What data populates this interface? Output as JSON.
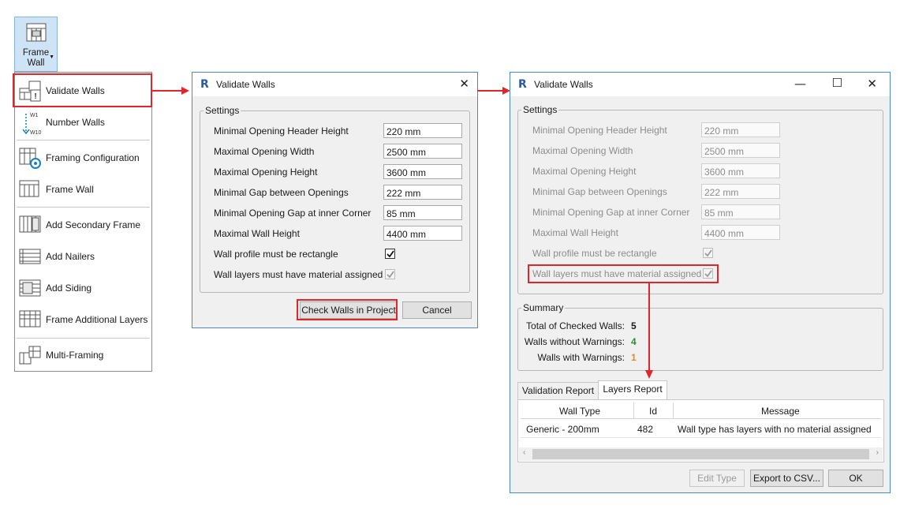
{
  "ribbon": {
    "label_line1": "Frame",
    "label_line2": "Wall"
  },
  "menu": {
    "items": [
      {
        "label": "Validate Walls"
      },
      {
        "label": "Number Walls"
      },
      {
        "label": "Framing Configuration"
      },
      {
        "label": "Frame Wall"
      },
      {
        "label": "Add Secondary Frame"
      },
      {
        "label": "Add Nailers"
      },
      {
        "label": "Add Siding"
      },
      {
        "label": "Frame Additional Layers"
      },
      {
        "label": "Multi-Framing"
      }
    ],
    "number_walls_icon_top": "W1",
    "number_walls_icon_bottom": "W10"
  },
  "dialog1": {
    "title": "Validate Walls",
    "logo": "R",
    "settings_legend": "Settings",
    "rows": [
      {
        "label": "Minimal Opening Header Height",
        "value": "220 mm"
      },
      {
        "label": "Maximal Opening Width",
        "value": "2500 mm"
      },
      {
        "label": "Maximal Opening Height",
        "value": "3600 mm"
      },
      {
        "label": "Minimal Gap between Openings",
        "value": "222 mm"
      },
      {
        "label": "Minimal Opening Gap at inner Corner",
        "value": "85 mm"
      },
      {
        "label": "Maximal Wall Height",
        "value": "4400 mm"
      }
    ],
    "checks": [
      {
        "label": "Wall profile must be rectangle",
        "checked": true
      },
      {
        "label": "Wall layers must have material assigned",
        "checked": true
      }
    ],
    "check_button": "Check Walls in Project",
    "cancel_button": "Cancel"
  },
  "dialog2": {
    "title": "Validate Walls",
    "logo": "R",
    "settings_legend": "Settings",
    "rows": [
      {
        "label": "Minimal Opening Header Height",
        "value": "220 mm"
      },
      {
        "label": "Maximal Opening Width",
        "value": "2500 mm"
      },
      {
        "label": "Maximal Opening Height",
        "value": "3600 mm"
      },
      {
        "label": "Minimal Gap between Openings",
        "value": "222 mm"
      },
      {
        "label": "Minimal Opening Gap at inner Corner",
        "value": "85 mm"
      },
      {
        "label": "Maximal Wall Height",
        "value": "4400 mm"
      }
    ],
    "checks": [
      {
        "label": "Wall profile must be rectangle",
        "checked": true
      },
      {
        "label": "Wall layers must have material assigned",
        "checked": true
      }
    ],
    "summary_legend": "Summary",
    "summary": [
      {
        "label": "Total of Checked Walls:",
        "value": "5",
        "color": "#1a1a1a"
      },
      {
        "label": "Walls without Warnings:",
        "value": "4",
        "color": "#2e8b2e"
      },
      {
        "label": "Walls with Warnings:",
        "value": "1",
        "color": "#e8891a"
      }
    ],
    "tabs": [
      {
        "label": "Validation Report",
        "active": false
      },
      {
        "label": "Layers Report",
        "active": true
      }
    ],
    "grid": {
      "headers": [
        "Wall Type",
        "Id",
        "Message"
      ],
      "rows": [
        [
          "Generic - 200mm",
          "482",
          "Wall type has layers with no material assigned"
        ]
      ]
    },
    "edit_type_button": "Edit Type",
    "export_button": "Export to CSV...",
    "ok_button": "OK"
  },
  "colors": {
    "highlight": "#e0262b",
    "accent": "#4a89c6"
  }
}
